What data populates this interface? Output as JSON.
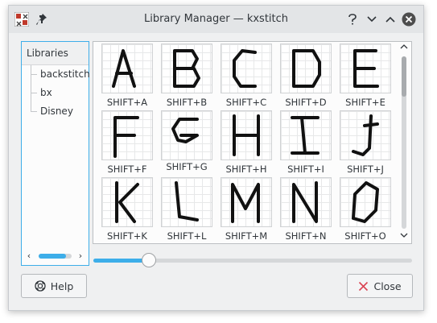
{
  "window": {
    "title": "Library Manager — kxstitch",
    "controls": [
      "help-icon",
      "minimize-icon",
      "maximize-icon",
      "close-icon"
    ]
  },
  "libraries": {
    "header": "Libraries",
    "items": [
      {
        "label": "backstitch"
      },
      {
        "label": "bx"
      },
      {
        "label": "Disney"
      }
    ],
    "hscroll_position": 0.8
  },
  "glyphs": [
    {
      "label": "SHIFT+A",
      "letter": "A"
    },
    {
      "label": "SHIFT+B",
      "letter": "B"
    },
    {
      "label": "SHIFT+C",
      "letter": "C"
    },
    {
      "label": "SHIFT+D",
      "letter": "D"
    },
    {
      "label": "SHIFT+E",
      "letter": "E"
    },
    {
      "label": "SHIFT+F",
      "letter": "F"
    },
    {
      "label": "SHIFT+G",
      "letter": "G"
    },
    {
      "label": "SHIFT+H",
      "letter": "H"
    },
    {
      "label": "SHIFT+I",
      "letter": "I"
    },
    {
      "label": "SHIFT+J",
      "letter": "J"
    },
    {
      "label": "SHIFT+K",
      "letter": "K"
    },
    {
      "label": "SHIFT+L",
      "letter": "L"
    },
    {
      "label": "SHIFT+M",
      "letter": "M"
    },
    {
      "label": "SHIFT+N",
      "letter": "N"
    },
    {
      "label": "SHIFT+O",
      "letter": "O"
    }
  ],
  "preview_scroll_position": 0.0,
  "zoom_level": 0.16,
  "buttons": {
    "help": {
      "label": "Help",
      "icon": "help-lifebuoy-icon"
    },
    "close": {
      "label": "Close",
      "icon": "close-x-icon"
    }
  },
  "colors": {
    "accent": "#3daee9",
    "close_icon": "#da4453",
    "stroke": "#111111"
  }
}
